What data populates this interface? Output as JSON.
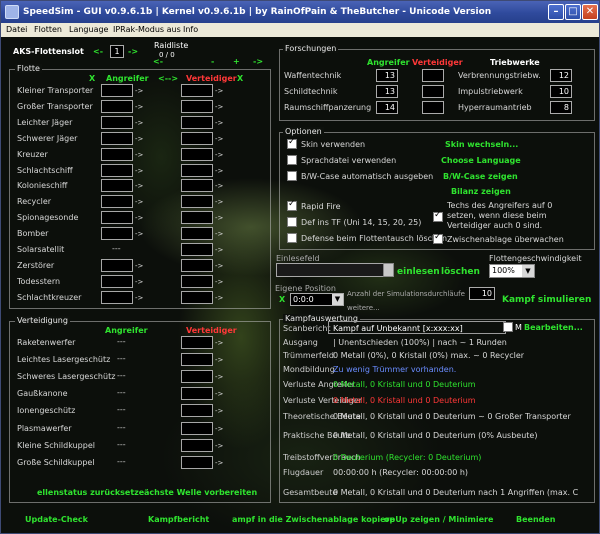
{
  "window": {
    "title": "SpeedSim - GUI v0.9.6.1b  |  Kernel v0.9.6.1b  |  by RainOfPain & TheButcher - Unicode Version"
  },
  "menu": [
    "Datei",
    "Flotten",
    "Language",
    "IPRak-Modus aus",
    "Info"
  ],
  "aks": {
    "label": "AKS-Flottenslot",
    "prev": "<-",
    "slot": "1",
    "next": "->",
    "raidliste": "Raidliste",
    "raid_counter": "0 / 0",
    "raid_prev": "<-",
    "raid_minus": "-",
    "raid_plus": "+",
    "raid_next": "->"
  },
  "flotte": {
    "group": "Flotte",
    "x_left": "X",
    "attacker": "Angreifer",
    "swap": "<-->",
    "defender": "Verteidiger",
    "x_right": "X",
    "ships": [
      {
        "name": "Kleiner Transporter",
        "attacker": "",
        "defender": ""
      },
      {
        "name": "Großer Transporter",
        "attacker": "",
        "defender": ""
      },
      {
        "name": "Leichter Jäger",
        "attacker": "",
        "defender": ""
      },
      {
        "name": "Schwerer Jäger",
        "attacker": "",
        "defender": ""
      },
      {
        "name": "Kreuzer",
        "attacker": "",
        "defender": ""
      },
      {
        "name": "Schlachtschiff",
        "attacker": "",
        "defender": ""
      },
      {
        "name": "Kolonieschiff",
        "attacker": "",
        "defender": ""
      },
      {
        "name": "Recycler",
        "attacker": "",
        "defender": ""
      },
      {
        "name": "Spionagesonde",
        "attacker": "",
        "defender": ""
      },
      {
        "name": "Bomber",
        "attacker": "",
        "defender": ""
      },
      {
        "name": "Solarsatellit",
        "attacker": "---",
        "defender": ""
      },
      {
        "name": "Zerstörer",
        "attacker": "",
        "defender": ""
      },
      {
        "name": "Todesstern",
        "attacker": "",
        "defender": ""
      },
      {
        "name": "Schlachtkreuzer",
        "attacker": "",
        "defender": ""
      }
    ]
  },
  "verteidigung": {
    "group": "Verteidigung",
    "attacker": "Angreifer",
    "defender": "Verteidiger",
    "items": [
      {
        "name": "Raketenwerfer",
        "attacker": "---"
      },
      {
        "name": "Leichtes Lasergeschütz",
        "attacker": "---"
      },
      {
        "name": "Schweres Lasergeschütz",
        "attacker": "---"
      },
      {
        "name": "Gaußkanone",
        "attacker": "---"
      },
      {
        "name": "Ionengeschütz",
        "attacker": "---"
      },
      {
        "name": "Plasmawerfer",
        "attacker": "---"
      },
      {
        "name": "Kleine Schildkuppel",
        "attacker": "---"
      },
      {
        "name": "Große Schildkuppel",
        "attacker": "---"
      }
    ],
    "btn_restore": "ellenstatus zurücksetze",
    "btn_next_wave": "ächste Welle vorbereiten"
  },
  "forschungen": {
    "group": "Forschungen",
    "attacker": "Angreifer",
    "defender": "Verteidiger",
    "drives": "Triebwerke",
    "techs": [
      {
        "name": "Waffentechnik",
        "attacker": "13",
        "defender": ""
      },
      {
        "name": "Schildtechnik",
        "attacker": "13",
        "defender": ""
      },
      {
        "name": "Raumschiffpanzerung",
        "attacker": "14",
        "defender": ""
      }
    ],
    "engines": [
      {
        "name": "Verbrennungstriebw.",
        "value": "12"
      },
      {
        "name": "Impulstriebwerk",
        "value": "10"
      },
      {
        "name": "Hyperraumantrieb",
        "value": "8"
      }
    ]
  },
  "optionen": {
    "group": "Optionen",
    "skin": "Skin verwenden",
    "sprachdatei": "Sprachdatei verwenden",
    "bwcase": "B/W-Case automatisch ausgeben",
    "rapidfire": "Rapid Fire",
    "def_tf": "Def ins TF (Uni 14, 15, 20, 25)",
    "defense_swap": "Defense beim Flottentausch löschen",
    "techs_note": "Techs des Angreifers auf 0 setzen, wenn diese beim Verteidiger auch 0 sind.",
    "clipboard": "Zwischenablage überwachen",
    "btn_skin": "Skin wechseln...",
    "btn_lang": "Choose Language",
    "btn_bwcase": "B/W-Case zeigen",
    "btn_bilanz": "Bilanz zeigen"
  },
  "einlesen": {
    "label": "Einlesefeld",
    "value": "",
    "btn_read": "einlesen",
    "btn_clear": "löschen",
    "speed_label": "Flottengeschwindigkeit",
    "speed_value": "100%"
  },
  "position": {
    "label": "Eigene Position",
    "x": "X",
    "coords": "0:0:0",
    "sim_label": "Anzahl der Simulationsdurchläufe",
    "sim_value": "10",
    "weitere": "weitere...",
    "btn_simulate": "Kampf simulieren"
  },
  "kampf": {
    "group": "Kampfauswertung",
    "rows": [
      {
        "label": "Scanbericht",
        "value": "Kampf auf Unbekannt [x:xxx:xx]",
        "color": "#ffffff"
      },
      {
        "label": "Ausgang",
        "value": "| Unentschieden (100%) | nach ~ 1 Runden",
        "color": "#d8d8d8"
      },
      {
        "label": "Trümmerfeld",
        "value": "0 Metall (0%), 0 Kristall (0%) max. ~ 0 Recycler",
        "color": "#d8d8d8"
      },
      {
        "label": "Mondbildung",
        "value": "Zu wenig Trümmer vorhanden.",
        "color": "#6a8cff"
      },
      {
        "label": "Verluste Angreifer",
        "value": "0 Metall, 0 Kristall und 0 Deuterium",
        "color": "#2fe32f"
      },
      {
        "label": "Verluste Verteidiger",
        "value": "0 Metall, 0 Kristall und 0 Deuterium",
        "color": "#ff3838"
      },
      {
        "label": "Theoretische Beute",
        "value": "0 Metall, 0 Kristall und 0 Deuterium ~ 0 Großer Transporter",
        "color": "#d8d8d8"
      },
      {
        "label": "Praktische Beute",
        "value": "0 Metall, 0 Kristall und 0 Deuterium (0% Ausbeute)",
        "color": "#d8d8d8"
      },
      {
        "label": "Treibstoffverbrauch",
        "value": "0 Deuterium (Recycler: 0 Deuterium)",
        "color": "#2fe32f"
      },
      {
        "label": "Flugdauer",
        "value": "00:00:00 h (Recycler: 00:00:00 h)",
        "color": "#d8d8d8"
      },
      {
        "label": "Gesamtbeute",
        "value": "0 Metall, 0 Kristall und 0 Deuterium nach 1 Angriffen (max. C",
        "color": "#d8d8d8"
      }
    ],
    "m_label": "M",
    "btn_edit": "Bearbeiten..."
  },
  "bottom": {
    "update": "Update-Check",
    "report": "Kampfbericht",
    "clipboard": "ampf in die Zwischenablage kopiere",
    "popup": "opUp zeigen / Minimiere",
    "exit": "Beenden"
  },
  "colors": {
    "green": "#2fe32f",
    "red": "#ff3838",
    "titlebar": "#2f4a9c"
  }
}
